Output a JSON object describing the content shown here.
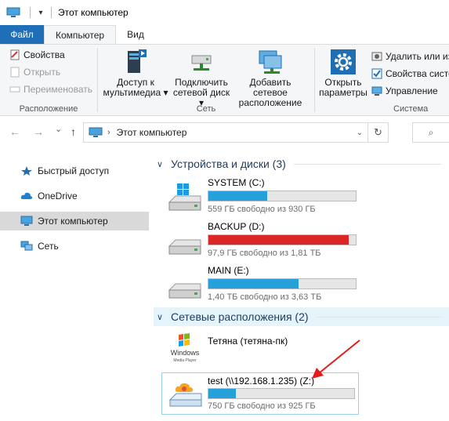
{
  "window": {
    "title": "Этот компьютер",
    "qa_dropdown": "▾"
  },
  "tabs": {
    "file": "Файл",
    "computer": "Компьютер",
    "view": "Вид"
  },
  "ribbon": {
    "location": {
      "label": "Расположение",
      "properties": "Свойства",
      "open": "Открыть",
      "rename": "Переименовать"
    },
    "network": {
      "label": "Сеть",
      "media_access_l1": "Доступ к",
      "media_access_l2": "мультимедиа ▾",
      "map_drive_l1": "Подключить",
      "map_drive_l2": "сетевой диск ▾",
      "add_location_l1": "Добавить сетевое",
      "add_location_l2": "расположение"
    },
    "system": {
      "label": "Система",
      "open_settings_l1": "Открыть",
      "open_settings_l2": "параметры",
      "uninstall": "Удалить или из",
      "system_props": "Свойства систе",
      "manage": "Управление"
    }
  },
  "address": {
    "path": "Этот компьютер",
    "back": "←",
    "forward": "→",
    "dropdown": "⌄",
    "up": "↑",
    "refresh": "↻",
    "search_icon": "⌕"
  },
  "nav": {
    "items": [
      {
        "label": "Быстрый доступ",
        "icon": "star-icon"
      },
      {
        "label": "OneDrive",
        "icon": "cloud-icon"
      },
      {
        "label": "Этот компьютер",
        "icon": "computer-icon"
      },
      {
        "label": "Сеть",
        "icon": "network-icon"
      }
    ]
  },
  "sections": {
    "devices": {
      "title": "Устройства и диски (3)"
    },
    "network": {
      "title": "Сетевые расположения (2)"
    }
  },
  "drives": [
    {
      "name": "SYSTEM (C:)",
      "free": "559 ГБ свободно из 930 ГБ",
      "used_fraction": 0.4,
      "color": "#26a0da"
    },
    {
      "name": "BACKUP (D:)",
      "free": "97,9 ГБ свободно из 1,81 ТБ",
      "used_fraction": 0.95,
      "color": "#da2626"
    },
    {
      "name": "MAIN (E:)",
      "free": "1,40 ТБ свободно из 3,63 ТБ",
      "used_fraction": 0.61,
      "color": "#26a0da"
    }
  ],
  "network_locations": {
    "media": {
      "name": "Тетяна (тетяна-пк)",
      "icon_text_l1": "Windows",
      "icon_text_l2": "Media Player"
    },
    "share": {
      "name": "test (\\\\192.168.1.235) (Z:)",
      "free": "750 ГБ свободно из 925 ГБ",
      "used_fraction": 0.19,
      "color": "#26a0da"
    }
  },
  "colors": {
    "accent": "#1e6fb8",
    "arrow": "#e21b1b",
    "bar_blue": "#26a0da",
    "bar_red": "#da2626"
  }
}
